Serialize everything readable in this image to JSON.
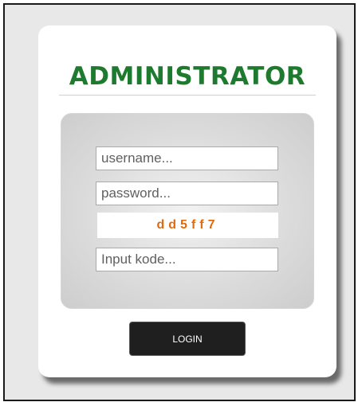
{
  "login_card": {
    "title": "ADMINISTRATOR",
    "username_placeholder": "username...",
    "password_placeholder": "password...",
    "captcha_code": "dd5ff7",
    "code_placeholder": "Input kode...",
    "login_label": "LOGIN"
  },
  "colors": {
    "title": "#1e7a2e",
    "captcha": "#e06b0c",
    "button": "#1f1f1f"
  }
}
